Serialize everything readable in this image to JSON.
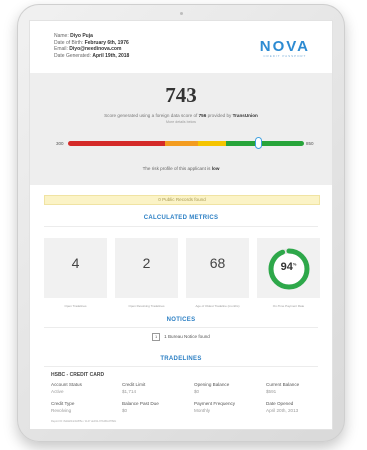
{
  "applicant": {
    "name_label": "Name:",
    "name": "Diyo Puja",
    "dob_label": "Date of Birth:",
    "dob": "February 6th, 1976",
    "email_label": "Email:",
    "email": "Diyo@needinova.com",
    "generated_label": "Date Generated:",
    "generated": "April 19th, 2018"
  },
  "brand": {
    "name": "NOVA",
    "tagline": "CREDIT PASSPORT",
    "color": "#2d8bd2"
  },
  "score": {
    "value": "743",
    "desc_prefix": "Score generated using a foreign data score of",
    "foreign_score": "756",
    "desc_middle": "provided by",
    "provider": "TransUnion",
    "more": "More details below",
    "min": "300",
    "max": "850",
    "marker_fraction": 0.807,
    "bar_colors": [
      "#d42a28",
      "#f39c1f",
      "#f5c400",
      "#27a43a"
    ],
    "risk_prefix": "The risk profile of this applicant is",
    "risk_value": "low"
  },
  "public_records": "0 Public Records found",
  "calculated_metrics": {
    "title": "CALCULATED METRICS",
    "cards": [
      {
        "value": "4",
        "label": "Open Tradelines"
      },
      {
        "value": "2",
        "label": "Open Revolving Tradelines"
      },
      {
        "value": "68",
        "label": "Age of Oldest Tradeline (months)"
      },
      {
        "value": "94",
        "unit": "%",
        "label": "On-Time Payment Rate",
        "fraction": 0.94,
        "color": "#2ea84a"
      }
    ]
  },
  "notices": {
    "title": "NOTICES",
    "count": "1",
    "text": "1 Bureau Notice found"
  },
  "tradelines": {
    "title": "TRADELINES",
    "name": "HSBC - CREDIT CARD",
    "fields": [
      {
        "label": "Account Status",
        "value": "Active"
      },
      {
        "label": "Credit Limit",
        "value": "$1,714"
      },
      {
        "label": "Opening Balance",
        "value": "$0"
      },
      {
        "label": "Current Balance",
        "value": "$591"
      },
      {
        "label": "Credit Type",
        "value": "Revolving"
      },
      {
        "label": "Balance Past Due",
        "value": "$0"
      },
      {
        "label": "Payment Frequency",
        "value": "Monthly"
      },
      {
        "label": "Date Opened",
        "value": "April 20th, 2013"
      }
    ]
  },
  "footer": "Report ID: 8a9d2b4c0c8f5e / 1147 ak031-97b4f0cd7f8dc"
}
